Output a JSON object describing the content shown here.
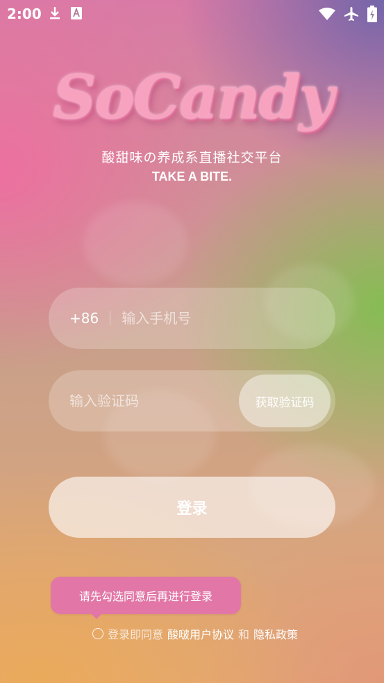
{
  "status_bar": {
    "time": "2:00",
    "left_icons": [
      "download-icon",
      "font-app-icon"
    ],
    "right_icons": [
      "wifi-icon",
      "airplane-icon",
      "battery-charging-icon"
    ]
  },
  "app": {
    "logo_text": "SoCandy",
    "tagline": "酸甜味の养成系直播社交平台",
    "slogan": "TAKE A BITE."
  },
  "phone": {
    "country_code": "+86",
    "placeholder": "输入手机号"
  },
  "code": {
    "placeholder": "输入验证码",
    "get_code_label": "获取验证码"
  },
  "login": {
    "label": "登录"
  },
  "tooltip": {
    "text": "请先勾选同意后再进行登录"
  },
  "agreement": {
    "prefix": "登录即同意",
    "user_agreement": "酸啵用户协议",
    "conjunction": "和",
    "privacy_policy": "隐私政策"
  },
  "colors": {
    "tooltip_bg": "#e277a7",
    "logo_pink": "#f7a3c0"
  }
}
